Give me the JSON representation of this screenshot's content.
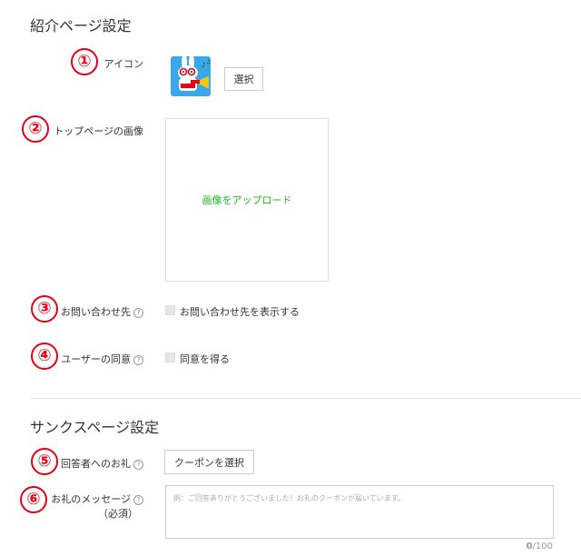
{
  "intro_section": {
    "title": "紹介ページ設定",
    "icon_field": {
      "number": "①",
      "label": "アイコン",
      "select_button": "選択"
    },
    "top_image_field": {
      "number": "②",
      "label": "トップページの画像",
      "upload_link": "画像をアップロード"
    },
    "contact_field": {
      "number": "③",
      "label": "お問い合わせ先",
      "help": "?",
      "checkbox_label": "お問い合わせ先を表示する",
      "checked": false
    },
    "consent_field": {
      "number": "④",
      "label": "ユーザーの同意",
      "help": "?",
      "checkbox_label": "同意を得る",
      "checked": false
    }
  },
  "thanks_section": {
    "title": "サンクスページ設定",
    "reward_field": {
      "number": "⑤",
      "label": "回答者へのお礼",
      "help": "?",
      "button": "クーポンを選択"
    },
    "message_field": {
      "number": "⑥",
      "label": "お礼のメッセージ",
      "help": "?",
      "required": "（必須）",
      "placeholder": "例：ご回答ありがとうございました！お礼のクーポンが届いています。",
      "counter_current": "0",
      "counter_max": "/100"
    }
  },
  "colors": {
    "accent_red": "#e60012",
    "upload_green": "#1db71d",
    "icon_bg": "#3aa7e8"
  },
  "icons": {
    "profile_icon": "bunny-character-icon"
  }
}
